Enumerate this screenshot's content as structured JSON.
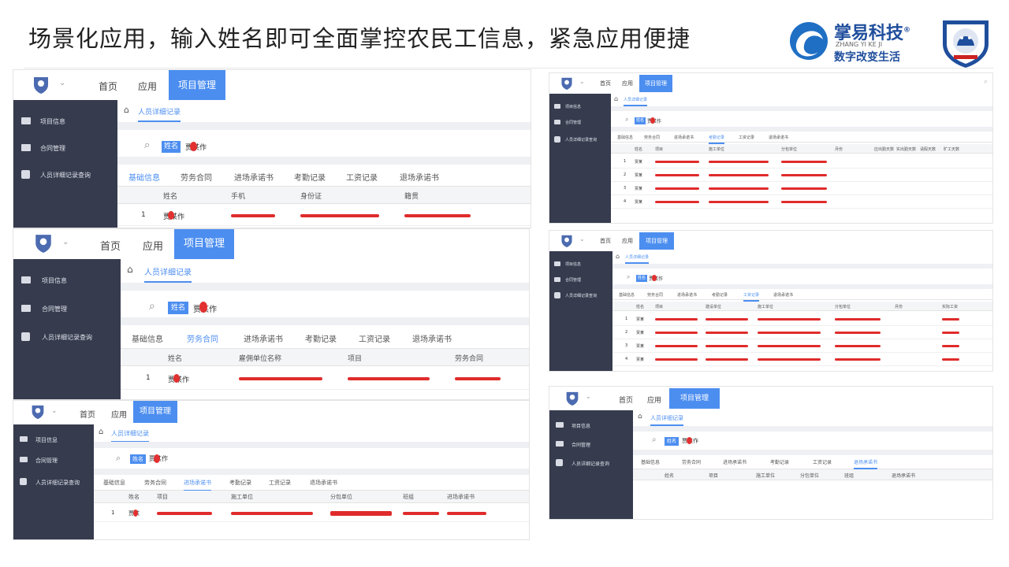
{
  "slide": {
    "title": "场景化应用，输入姓名即可全面掌控农民工信息，紧急应用便捷",
    "brand_name": "掌易科技",
    "brand_mark": "®",
    "brand_sub": "ZHANG YI KE JI",
    "brand_slogan": "数字改变生活"
  },
  "app": {
    "nav": {
      "home": "首页",
      "apps": "应用",
      "project": "项目管理"
    },
    "sidebar": {
      "project_info": "项目信息",
      "contract": "合同管理",
      "person_query": "人员详细记录查询"
    },
    "breadcrumb": "人员详细记录",
    "search_tag": "姓名",
    "search_value": "贾某作",
    "tabs": [
      "基础信息",
      "劳务合同",
      "进场承诺书",
      "考勤记录",
      "工资记录",
      "退场承诺书"
    ]
  },
  "panels": {
    "basic_info": {
      "headers": [
        "姓名",
        "手机",
        "身份证",
        "籍贯"
      ],
      "rows": [
        [
          "1",
          "贾某作"
        ]
      ]
    },
    "labor_contract": {
      "headers": [
        "姓名",
        "雇佣单位名称",
        "项目",
        "劳务合同"
      ],
      "rows": [
        [
          "1",
          "贾某作"
        ]
      ]
    },
    "entry_pledge": {
      "headers": [
        "姓名",
        "项目",
        "施工单位",
        "分包单位",
        "班组",
        "进场承诺书"
      ],
      "rows": [
        [
          "1",
          "贾某"
        ]
      ]
    },
    "attendance": {
      "headers": [
        "姓名",
        "项目",
        "施工单位",
        "分包单位",
        "月份",
        "应出勤天数",
        "实出勤天数",
        "请假天数",
        "旷工天数"
      ],
      "rows": [
        [
          "1",
          "贾某"
        ],
        [
          "2",
          "贾某"
        ],
        [
          "3",
          "贾某"
        ],
        [
          "4",
          "贾某"
        ]
      ]
    },
    "wage": {
      "headers": [
        "姓名",
        "项目",
        "建设单位",
        "施工单位",
        "分包单位",
        "月份",
        "实际工资"
      ],
      "rows": [
        [
          "1",
          "贾某"
        ],
        [
          "2",
          "贾某"
        ],
        [
          "3",
          "贾某"
        ],
        [
          "4",
          "贾某"
        ]
      ]
    },
    "exit_pledge": {
      "headers": [
        "姓名",
        "项目",
        "施工单位",
        "分包单位",
        "班组",
        "退场承诺书"
      ],
      "rows": []
    }
  },
  "colors": {
    "accent": "#4c8ef0",
    "sidebar": "#363b4e",
    "redaction": "#e02b2b",
    "brand": "#1f4e9c"
  }
}
